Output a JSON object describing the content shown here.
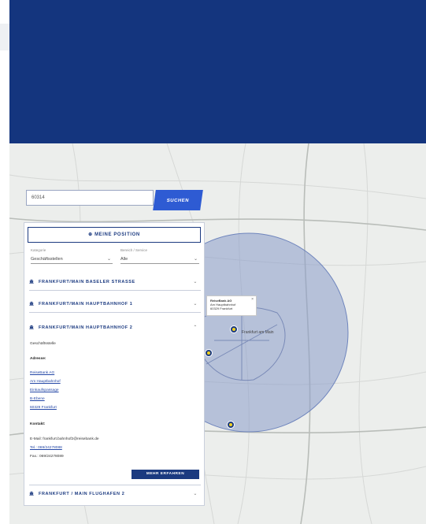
{
  "search": {
    "value": "60314",
    "button_label": "SUCHEN"
  },
  "panel": {
    "position_button": "⊕ MEINE POSITION",
    "filter1": {
      "label": "Kategorie",
      "value": "Geschäftsstellen"
    },
    "filter2": {
      "label": "Bereich / Service",
      "value": "Alle"
    },
    "locations": [
      {
        "name": "FRANKFURT/MAIN BASELER STRASSE"
      },
      {
        "name": "FRANKFURT/MAIN HAUPTBAHNHOF 1"
      },
      {
        "name": "FRANKFURT/MAIN HAUPTBAHNHOF 2"
      },
      {
        "name": "FRANKFURT / MAIN FLUGHAFEN 2"
      }
    ],
    "detail": {
      "type": "Geschäftsstelle",
      "address_heading": "Adresse:",
      "address_lines": [
        "ReiseBank AG",
        "Am Hauptbahnhof",
        "Einkaufspassage",
        "B-Ebene",
        "60329 Frankfurt"
      ],
      "contact_heading": "Kontakt:",
      "email": "E-Mail: frankfurt.bahnhof2@reisebank.de",
      "phone": "Tel.: 069/24278088",
      "fax": "Fax.: 069/24278089",
      "route_button": "MEHR ERFAHREN"
    }
  },
  "popup": {
    "title": "ReiseBank AG",
    "line1": "Am Hauptbahnhof",
    "line2": "60329 Frankfurt",
    "close": "×"
  },
  "map_labels": [
    "Frankfurt am Main"
  ],
  "colors": {
    "hero": "#14357e",
    "accent": "#2e5bd3",
    "radius": "#8a9ccb",
    "marker": "#1b3a80",
    "marker_dot": "#f2d21f"
  }
}
